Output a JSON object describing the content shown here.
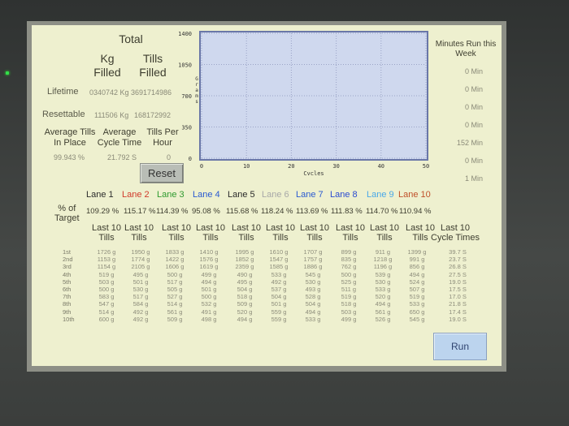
{
  "header": {
    "total": "Total",
    "kg_filled": "Kg\nFilled",
    "tills_filled": "Tills\nFilled"
  },
  "lifetime": {
    "label": "Lifetime",
    "kg": "0340742 Kg",
    "tills": "3691714986"
  },
  "resettable": {
    "label": "Resettable",
    "kg": "111506 Kg",
    "tills": "168172992"
  },
  "averages": {
    "tills_label": "Average Tills In Place",
    "cycle_label": "Average Cycle Time",
    "tph_label": "Tills Per Hour",
    "tills_value": "99.943 %",
    "cycle_value": "21.792 S",
    "tph_value": "0"
  },
  "reset_label": "Reset",
  "run_label": "Run",
  "minutes": {
    "title": "Minutes Run this Week",
    "values": [
      "0 Min",
      "0 Min",
      "0 Min",
      "0 Min",
      "152 Min",
      "0 Min",
      "1 Min"
    ]
  },
  "chart_data": {
    "type": "line",
    "xlabel": "Cycles",
    "ylabel": "Grams",
    "xlim": [
      0,
      50
    ],
    "ylim": [
      0,
      1400
    ],
    "x_ticks": [
      "0",
      "10",
      "20",
      "30",
      "40",
      "50"
    ],
    "y_ticks": [
      "0",
      "350",
      "700",
      "1050",
      "1400"
    ],
    "grid": true,
    "series": []
  },
  "lanes": {
    "labels": [
      "Lane 1",
      "Lane 2",
      "Lane 3",
      "Lane 4",
      "Lane 5",
      "Lane 6",
      "Lane 7",
      "Lane 8",
      "Lane 9",
      "Lane 10"
    ],
    "colors": [
      "#2b2b2b",
      "#d03a2a",
      "#2e9a2e",
      "#2a5ad0",
      "#2b2b2b",
      "#a8a8a8",
      "#2a5ad0",
      "#2a4ad0",
      "#4aa8e8",
      "#c0502a"
    ],
    "pct_label": "% of\nTarget",
    "pct_values": [
      "109.29 %",
      "115.17 %",
      "114.39 %",
      "95.08 %",
      "115.68 %",
      "118.24 %",
      "113.69 %",
      "111.83 %",
      "114.70 %",
      "110.94 %"
    ]
  },
  "table": {
    "col_header": "Last 10 Tills",
    "cycle_header": "Last 10 Cycle Times",
    "row_labels": [
      "1st",
      "2nd",
      "3rd",
      "4th",
      "5th",
      "6th",
      "7th",
      "8th",
      "9th",
      "10th"
    ],
    "rows": [
      [
        "1726 g",
        "1950 g",
        "1833 g",
        "1410 g",
        "1995 g",
        "1610 g",
        "1707 g",
        "899 g",
        "911 g",
        "1399 g",
        "39.7 S"
      ],
      [
        "1153 g",
        "1774 g",
        "1422 g",
        "1576 g",
        "1852 g",
        "1547 g",
        "1757 g",
        "835 g",
        "1218 g",
        "991 g",
        "23.7 S"
      ],
      [
        "1154 g",
        "2105 g",
        "1606 g",
        "1619 g",
        "2359 g",
        "1585 g",
        "1886 g",
        "762 g",
        "1196 g",
        "856 g",
        "26.8 S"
      ],
      [
        "519 g",
        "495 g",
        "500 g",
        "499 g",
        "490 g",
        "533 g",
        "545 g",
        "500 g",
        "539 g",
        "494 g",
        "27.5 S"
      ],
      [
        "503 g",
        "501 g",
        "517 g",
        "494 g",
        "495 g",
        "492 g",
        "530 g",
        "525 g",
        "530 g",
        "524 g",
        "19.0 S"
      ],
      [
        "500 g",
        "530 g",
        "505 g",
        "501 g",
        "504 g",
        "537 g",
        "493 g",
        "511 g",
        "533 g",
        "507 g",
        "17.5 S"
      ],
      [
        "583 g",
        "517 g",
        "527 g",
        "500 g",
        "518 g",
        "504 g",
        "528 g",
        "519 g",
        "520 g",
        "519 g",
        "17.0 S"
      ],
      [
        "547 g",
        "584 g",
        "514 g",
        "532 g",
        "509 g",
        "501 g",
        "504 g",
        "518 g",
        "494 g",
        "533 g",
        "21.8 S"
      ],
      [
        "514 g",
        "492 g",
        "561 g",
        "491 g",
        "520 g",
        "559 g",
        "494 g",
        "503 g",
        "561 g",
        "650 g",
        "17.4 S"
      ],
      [
        "600 g",
        "492 g",
        "509 g",
        "498 g",
        "494 g",
        "559 g",
        "533 g",
        "499 g",
        "526 g",
        "545 g",
        "19.0 S"
      ]
    ]
  }
}
